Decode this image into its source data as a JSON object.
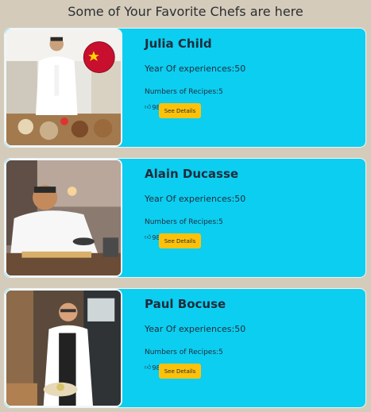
{
  "header": {
    "title": "Some of Your Favorite Chefs are here"
  },
  "chefs": [
    {
      "name": "Julia Child",
      "experience": "Year Of experiences:50",
      "recipes": "Numbers of Recipes:5",
      "likes": "98",
      "button": "See Details",
      "photo": "chef-in-kitchen-with-flag-photo"
    },
    {
      "name": "Alain Ducasse",
      "experience": "Year Of experiences:50",
      "recipes": "Numbers of Recipes:5",
      "likes": "98",
      "button": "See Details",
      "photo": "chef-cooking-at-counter-photo"
    },
    {
      "name": "Paul Bocuse",
      "experience": "Year Of experiences:50",
      "recipes": "Numbers of Recipes:5",
      "likes": "98",
      "button": "See Details",
      "photo": "chef-holding-plate-photo"
    }
  ],
  "icons": {
    "like": "thumbs-up-icon"
  },
  "colors": {
    "background": "#d5cbba",
    "card": "#0ccef0",
    "button": "#fcc20b"
  }
}
